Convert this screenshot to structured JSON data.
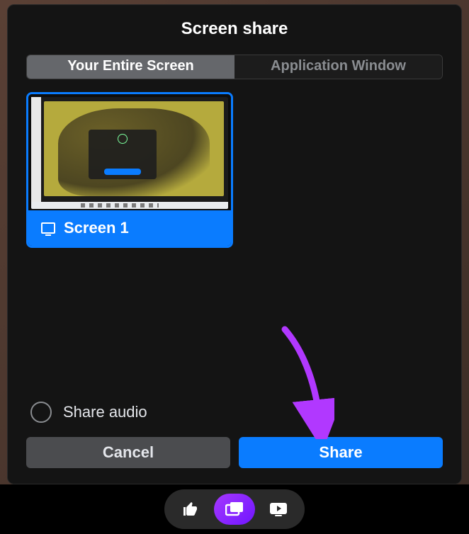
{
  "dialog": {
    "title": "Screen share",
    "tabs": [
      {
        "label": "Your Entire Screen",
        "active": true
      },
      {
        "label": "Application Window",
        "active": false
      }
    ],
    "screens": [
      {
        "label": "Screen 1",
        "selected": true
      }
    ],
    "share_audio": {
      "label": "Share audio",
      "checked": false
    },
    "cancel_label": "Cancel",
    "share_label": "Share"
  },
  "bottom_bar": {
    "buttons": [
      {
        "name": "thumbs-up",
        "active": false
      },
      {
        "name": "screen-share",
        "active": true
      },
      {
        "name": "watch-together",
        "active": false
      }
    ]
  },
  "annotation": {
    "arrow_color": "#b138ff"
  }
}
